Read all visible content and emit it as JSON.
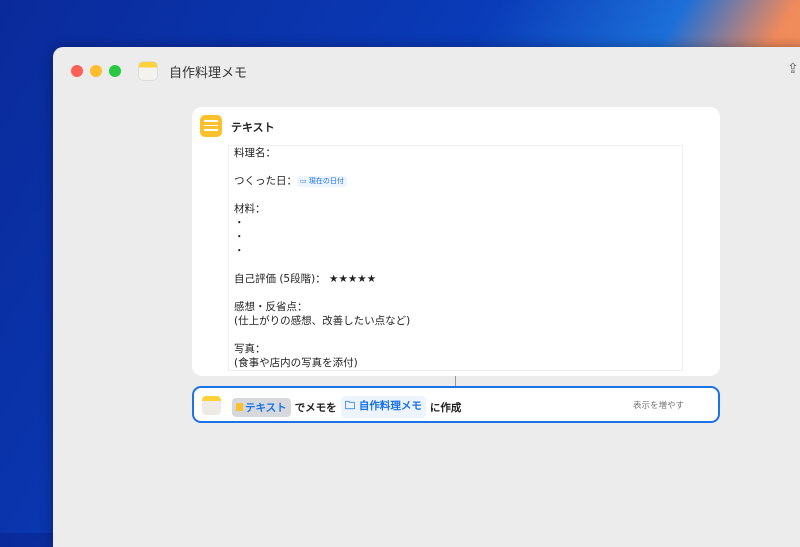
{
  "window": {
    "title": "自作料理メモ"
  },
  "text_card": {
    "title": "テキスト",
    "lines": [
      "料理名：",
      "",
      "つくった日：",
      "",
      "材料：",
      "・",
      "・",
      "・",
      "",
      "自己評価 (5段階)： ★★★★★",
      "",
      "感想・反省点：",
      "(仕上がりの感想、改善したい点など)",
      "",
      "写真：",
      "(食事や店内の写真を添付)"
    ],
    "date_token": "現在の日付"
  },
  "action": {
    "variable": "テキスト",
    "text1": "でメモを",
    "folder": "自作料理メモ",
    "text2": "に作成",
    "more": "表示を増やす"
  }
}
